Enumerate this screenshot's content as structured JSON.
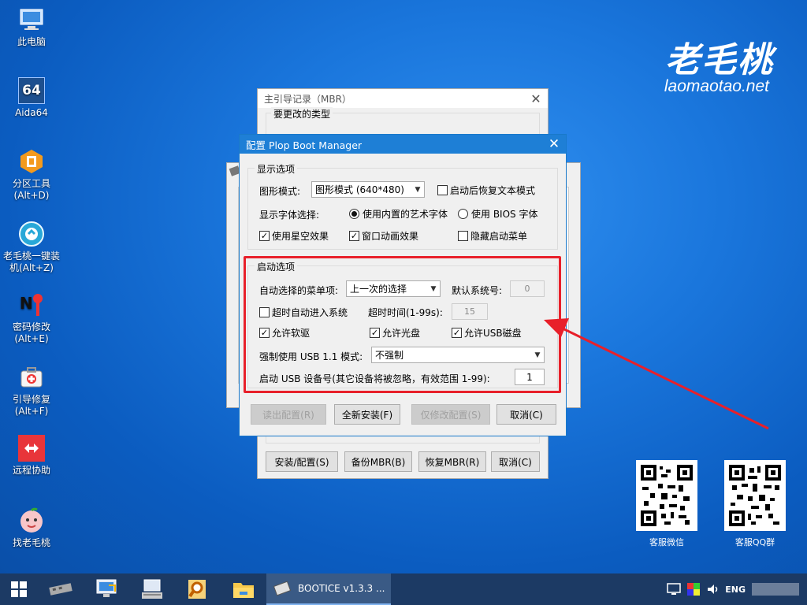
{
  "desktop": {
    "icons": [
      {
        "label": "此电脑"
      },
      {
        "label": "Aida64",
        "badge": "64"
      },
      {
        "label": "分区工具(Alt+D)"
      },
      {
        "label": "老毛桃一键装机(Alt+Z)"
      },
      {
        "label": "密码修改(Alt+E)"
      },
      {
        "label": "引导修复(Alt+F)"
      },
      {
        "label": "远程协助"
      },
      {
        "label": "找老毛桃"
      }
    ],
    "logo_cn": "老毛桃",
    "logo_url": "laomaotao.net",
    "qr": [
      {
        "label": "客服微信"
      },
      {
        "label": "客服QQ群"
      }
    ]
  },
  "mbr_window": {
    "title": "主引导记录（MBR）",
    "group_label": "要更改的类型",
    "buttons": {
      "install": "安装/配置(S)",
      "backup": "备份MBR(B)",
      "restore": "恢复MBR(R)",
      "cancel": "取消(C)"
    }
  },
  "plop_dialog": {
    "title": "配置 Plop Boot Manager",
    "display_group": {
      "legend": "显示选项",
      "graphics_mode_label": "图形模式:",
      "graphics_mode_value": "图形模式 (640*480)",
      "restore_text_mode": "启动后恢复文本模式",
      "font_label": "显示字体选择:",
      "font_builtin": "使用内置的艺术字体",
      "font_bios": "使用 BIOS 字体",
      "starfield": "使用星空效果",
      "window_anim": "窗口动画效果",
      "hide_menu": "隐藏启动菜单"
    },
    "boot_group": {
      "legend": "启动选项",
      "auto_select_label": "自动选择的菜单项:",
      "auto_select_value": "上一次的选择",
      "default_sys_label": "默认系统号:",
      "default_sys_value": "0",
      "timeout_enter": "超时自动进入系统",
      "timeout_label": "超时时间(1-99s):",
      "timeout_value": "15",
      "allow_floppy": "允许软驱",
      "allow_cdrom": "允许光盘",
      "allow_usb": "允许USB磁盘",
      "usb11_label": "强制使用 USB 1.1 模式:",
      "usb11_value": "不强制",
      "usb_dev_label": "启动 USB 设备号(其它设备将被忽略，有效范围 1-99):",
      "usb_dev_value": "1"
    },
    "buttons": {
      "read_config": "读出配置(R)",
      "new_install": "全新安装(F)",
      "modify_only": "仅修改配置(S)",
      "cancel": "取消(C)"
    }
  },
  "taskbar": {
    "active_app": "BOOTICE v1.3.3 ...",
    "tray_lang": "ENG"
  },
  "colors": {
    "annotation_red": "#e8202a",
    "title_blue": "#1e7fd6"
  }
}
